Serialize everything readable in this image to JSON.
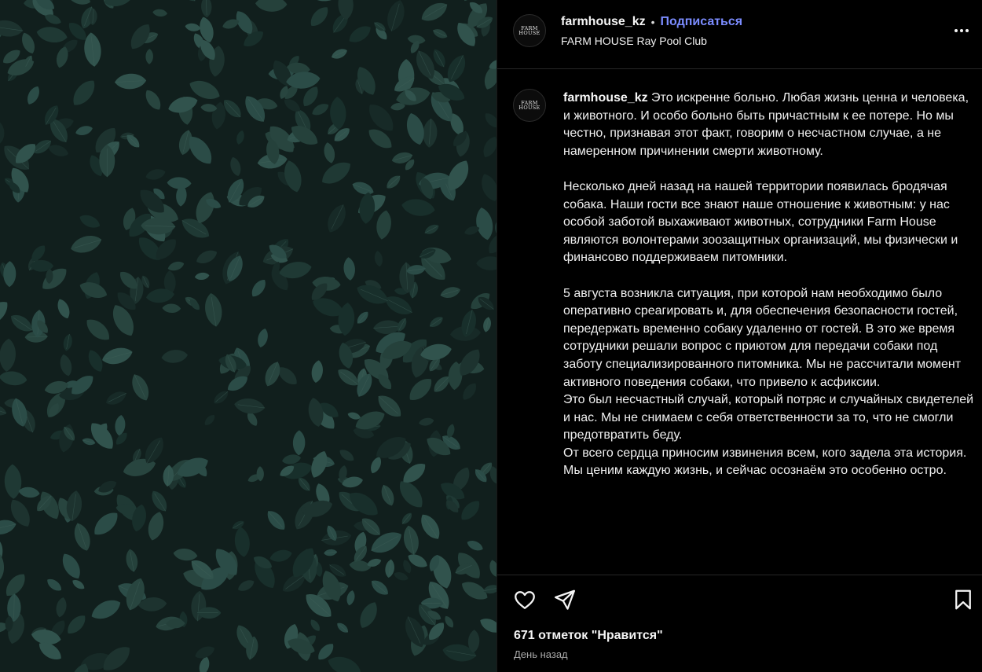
{
  "post": {
    "author": {
      "username": "farmhouse_kz",
      "follow_label": "Подписаться",
      "separator": "•",
      "location": "FARM HOUSE Ray Pool Club",
      "avatar_logo": [
        "FARM",
        "HOUSE"
      ]
    },
    "caption": {
      "username": "farmhouse_kz",
      "paragraphs": [
        [
          "Это искренне больно. Любая жизнь ценна и человека, и животного. И особо больно быть причастным к ее потере. Но мы честно, признавая этот факт, говорим о несчастном случае, а не намеренном причинении смерти животному."
        ],
        [
          "Несколько дней назад на нашей территории появилась бродячая собака. Наши гости все знают наше отношение к животным: у нас особой заботой выхаживают животных, сотрудники Farm House являются волонтерами зоозащитных организаций, мы физически и финансово поддерживаем питомники."
        ],
        [
          "5 августа возникла ситуация, при которой нам необходимо было оперативно среагировать и, для обеспечения безопасности гостей, передержать временно собаку удаленно от гостей. В это же время сотрудники решали вопрос с приютом для передачи собаки под заботу специализированного питомника. Мы не рассчитали момент активного поведения собаки, что привело к асфиксии.",
          "Это был несчастный случай, который потряс и случайных свидетелей и нас. Мы не снимаем с себя ответственности за то, что не смогли предотвратить беду.",
          "От всего сердца приносим извинения всем, кого задела эта история.",
          "Мы ценим каждую жизнь, и сейчас осознаём это особенно остро."
        ]
      ]
    },
    "likes_text": "671 отметок \"Нравится\"",
    "time_text": "День назад"
  },
  "icons": {
    "like": "heart-icon",
    "share": "paper-plane-icon",
    "save": "bookmark-icon",
    "more": "more-horizontal-icon"
  },
  "colors": {
    "background": "#000000",
    "text": "#f5f5f5",
    "follow": "#7b8cff",
    "muted": "#a8a8a8",
    "ivy_dark": "#13221f",
    "ivy_leaf": "#2e4f48"
  }
}
